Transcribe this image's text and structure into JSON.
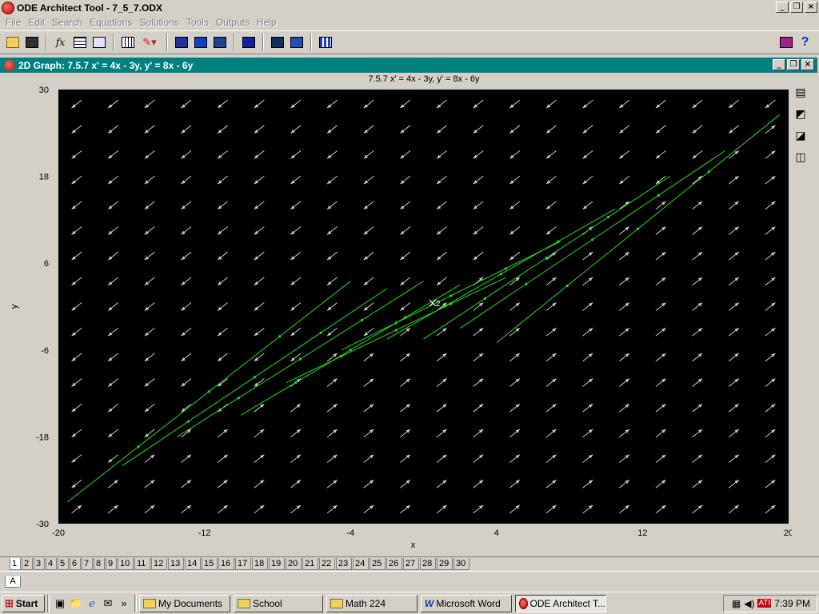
{
  "app": {
    "title": "ODE Architect Tool - 7_5_7.ODX",
    "menu": [
      "File",
      "Edit",
      "Search",
      "Equations",
      "Solutions",
      "Tools",
      "Outputs",
      "Help"
    ]
  },
  "child_window": {
    "title": "2D Graph: 7.5.7  x' = 4x - 3y,   y' = 8x - 6y"
  },
  "graph": {
    "title": "7.5.7  x' = 4x - 3y,   y' = 8x - 6y",
    "marker_label": "2"
  },
  "chart_data": {
    "type": "line",
    "title": "7.5.7  x' = 4x - 3y,   y' = 8x - 6y",
    "xlabel": "x",
    "ylabel": "y",
    "xlim": [
      -20,
      20
    ],
    "ylim": [
      -30,
      30
    ],
    "x_ticks": [
      -20,
      -12,
      -4,
      4,
      12,
      20
    ],
    "y_ticks": [
      30,
      18,
      6,
      -6,
      -18,
      -30
    ],
    "background": "#000000",
    "trajectory_color": "#22dd22",
    "field_color": "#c8c8c8",
    "marker": {
      "x": 0.5,
      "y": 0.5
    },
    "trajectories": [
      {
        "x0": -19.5,
        "y0": -27.0,
        "x1": -4.0,
        "y1": 3.5
      },
      {
        "x0": -16.5,
        "y0": -22.0,
        "x1": -2.0,
        "y1": 2.5
      },
      {
        "x0": -13.5,
        "y0": -18.0,
        "x1": 0.0,
        "y1": 3.5
      },
      {
        "x0": -10.0,
        "y0": -15.0,
        "x1": 2.0,
        "y1": 3.0
      },
      {
        "x0": -7.5,
        "y0": -10.5,
        "x1": 4.5,
        "y1": 4.0
      },
      {
        "x0": -4.5,
        "y0": -6.0,
        "x1": 7.5,
        "y1": 9.0
      },
      {
        "x0": -2.0,
        "y0": -4.5,
        "x1": 10.5,
        "y1": 13.5
      },
      {
        "x0": 0.0,
        "y0": -4.5,
        "x1": 13.5,
        "y1": 18.0
      },
      {
        "x0": 2.0,
        "y0": -3.0,
        "x1": 16.5,
        "y1": 21.5
      },
      {
        "x0": 4.0,
        "y0": -5.0,
        "x1": 19.5,
        "y1": 26.5
      }
    ]
  },
  "tabs": [
    "1",
    "2",
    "3",
    "4",
    "5",
    "6",
    "7",
    "8",
    "9",
    "10",
    "11",
    "12",
    "13",
    "14",
    "15",
    "16",
    "17",
    "18",
    "19",
    "20",
    "21",
    "22",
    "23",
    "24",
    "25",
    "26",
    "27",
    "28",
    "29",
    "30"
  ],
  "sheet": "A",
  "taskbar": {
    "start": "Start",
    "tasks": [
      "My Documents",
      "School",
      "Math 224",
      "Microsoft Word",
      "ODE Architect T..."
    ],
    "clock": "7:39 PM"
  }
}
